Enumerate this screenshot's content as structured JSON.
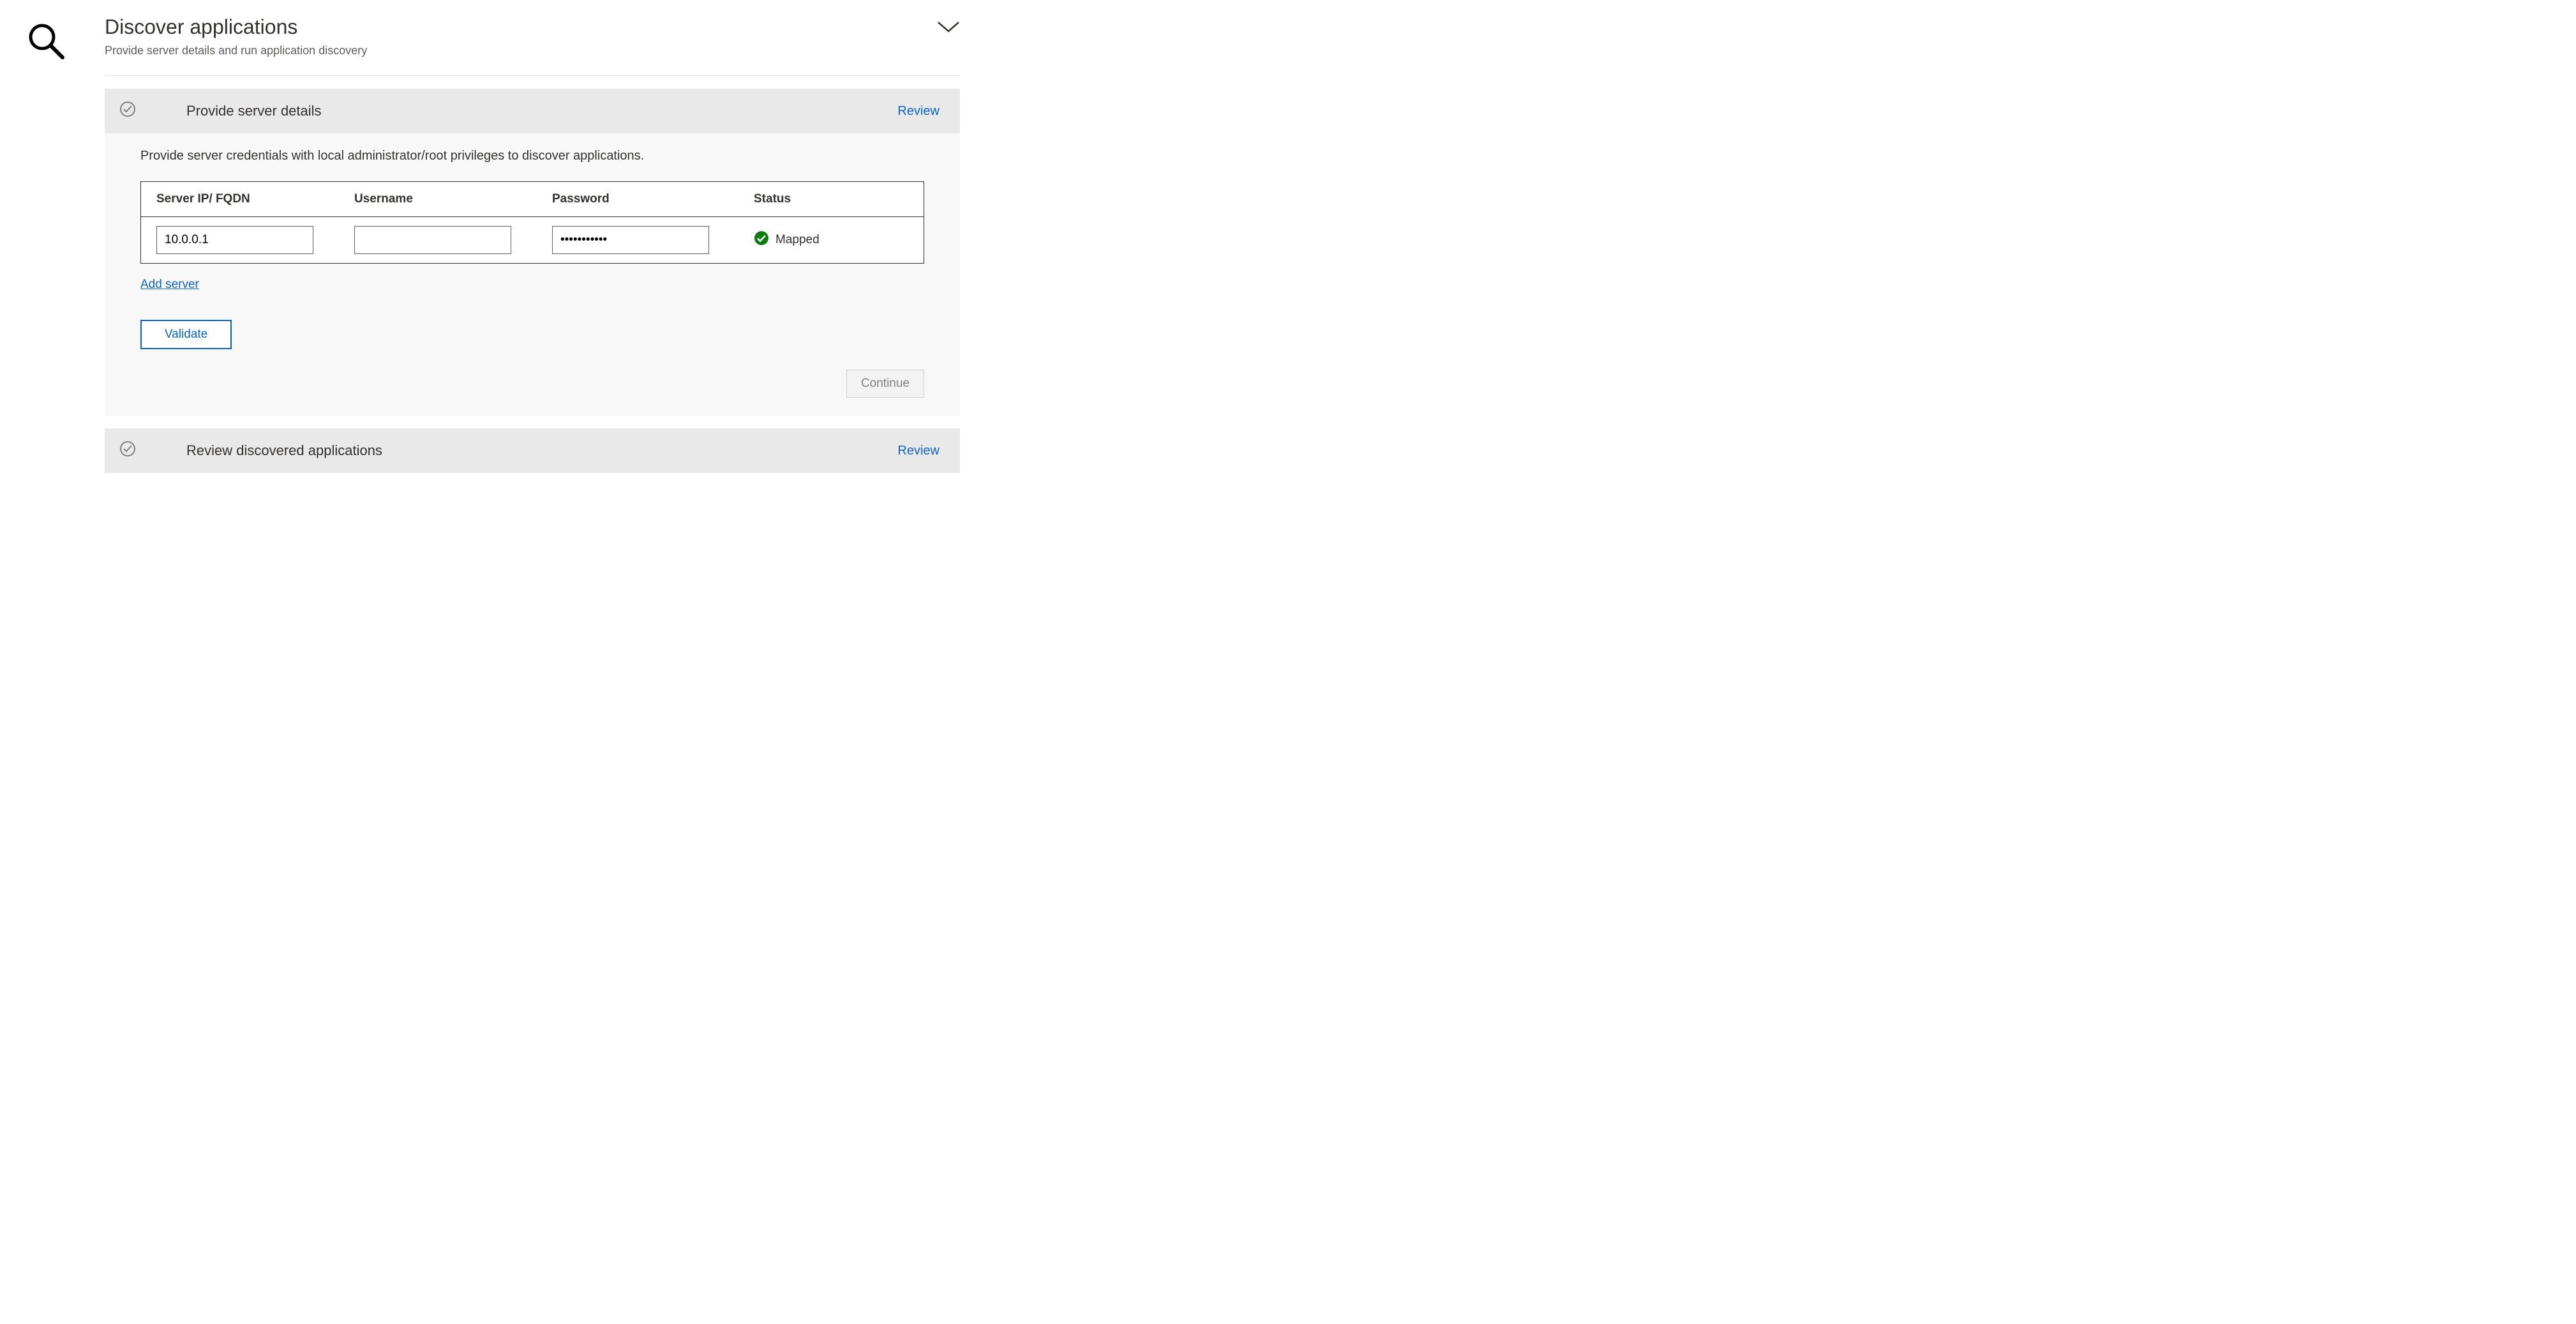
{
  "header": {
    "title": "Discover applications",
    "subtitle": "Provide server details and run application discovery"
  },
  "section1": {
    "title": "Provide server details",
    "review_label": "Review",
    "instruction": "Provide server credentials with local administrator/root privileges to discover applications.",
    "columns": {
      "ip": "Server IP/ FQDN",
      "username": "Username",
      "password": "Password",
      "status": "Status"
    },
    "row": {
      "ip_value": "10.0.0.1",
      "username_value": "",
      "password_value": "•••••••••••",
      "status_text": "Mapped"
    },
    "add_server_label": "Add server",
    "validate_label": "Validate",
    "continue_label": "Continue"
  },
  "section2": {
    "title": "Review discovered applications",
    "review_label": "Review"
  },
  "icons": {
    "search": "search-icon",
    "chevron_down": "chevron-down-icon",
    "check_circle_outline": "check-circle-outline-icon",
    "check_circle_solid": "check-circle-solid-icon"
  }
}
